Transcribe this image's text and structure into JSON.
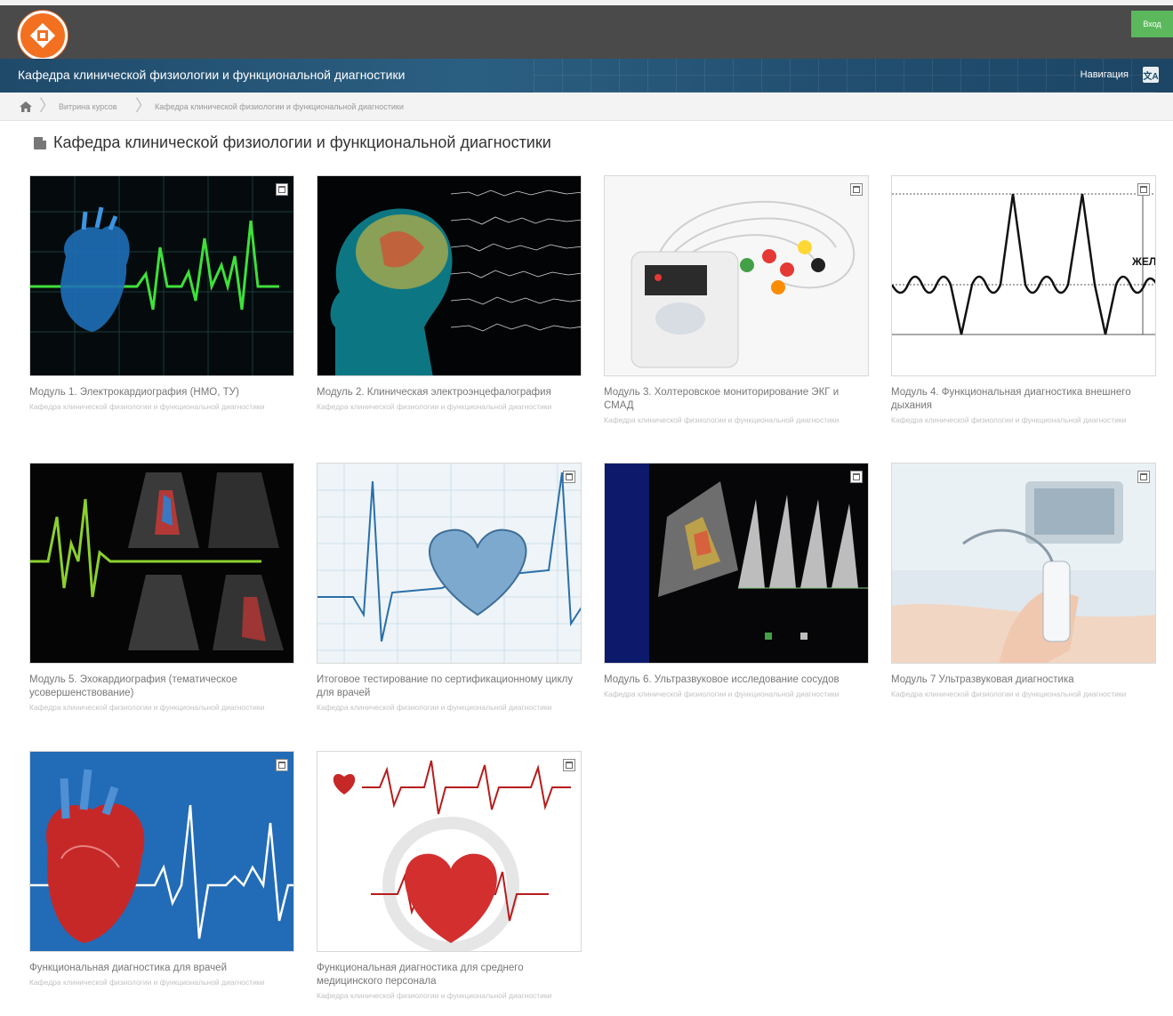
{
  "header": {
    "login_label": "Вход",
    "logo_icon": "logo-icon"
  },
  "banner": {
    "title": "Кафедра клинической физиологии и функциональной диагностики",
    "nav_label": "Навигация",
    "lang_icon": "translate-icon",
    "lang_glyph": "文A"
  },
  "breadcrumb": {
    "home_icon": "home-icon",
    "items": [
      "Витрина курсов",
      "Кафедра клинической физиологии и функциональной диагностики"
    ]
  },
  "page": {
    "title": "Кафедра клинической физиологии и функциональной диагностики"
  },
  "courses": [
    {
      "title": "Модуль 1. Электрокардиография (НМО, ТУ)",
      "subtitle": "Кафедра клинической физиологии и функциональной диагностики"
    },
    {
      "title": "Модуль 2. Клиническая электроэнцефалография",
      "subtitle": "Кафедра клинической физиологии и функциональной диагностики"
    },
    {
      "title": "Модуль 3. Холтеровское мониторирование ЭКГ и СМАД",
      "subtitle": "Кафедра клинической физиологии и функциональной диагностики"
    },
    {
      "title": "Модуль 4. Функциональная диагностика внешнего дыхания",
      "subtitle": "Кафедра клинической физиологии и функциональной диагностики"
    },
    {
      "title": "Модуль 5. Эхокардиография (тематическое усовершенствование)",
      "subtitle": "Кафедра клинической физиологии и функциональной диагностики"
    },
    {
      "title": "Итоговое тестирование по сертификационному циклу для врачей",
      "subtitle": "Кафедра клинической физиологии и функциональной диагностики"
    },
    {
      "title": "Модуль 6. Ультразвуковое исследование сосудов",
      "subtitle": "Кафедра клинической физиологии и функциональной диагностики"
    },
    {
      "title": "Модуль 7 Ультразвуковая диагностика",
      "subtitle": "Кафедра клинической физиологии и функциональной диагностики"
    },
    {
      "title": "Функциональная диагностика для врачей",
      "subtitle": "Кафедра клинической физиологии и функциональной диагностики"
    },
    {
      "title": "Функциональная диагностика для среднего медицинского персонала",
      "subtitle": "Кафедра клинической физиологии и функциональной диагностики"
    }
  ],
  "misc": {
    "volume_label": "ЖЕЛ"
  }
}
